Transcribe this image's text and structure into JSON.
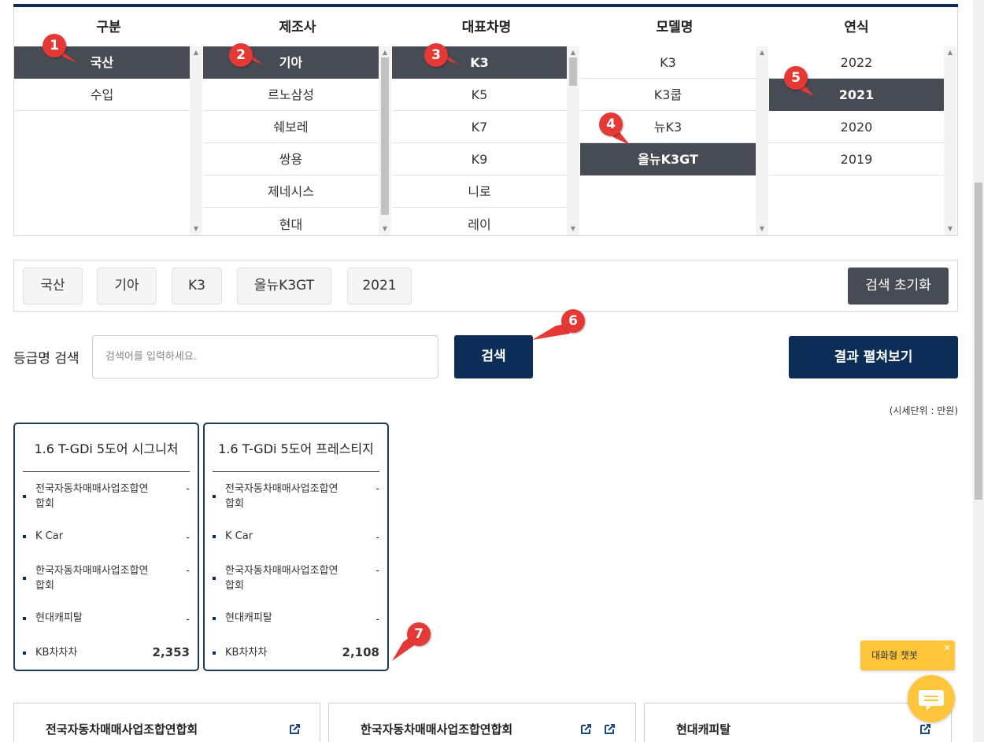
{
  "columns": [
    {
      "header": "구분",
      "items": [
        "국산",
        "수입"
      ],
      "selected": 0
    },
    {
      "header": "제조사",
      "items": [
        "기아",
        "르노삼성",
        "쉐보레",
        "쌍용",
        "제네시스",
        "현대"
      ],
      "selected": 0
    },
    {
      "header": "대표차명",
      "items": [
        "K3",
        "K5",
        "K7",
        "K9",
        "니로",
        "레이"
      ],
      "selected": 0
    },
    {
      "header": "모델명",
      "items": [
        "K3",
        "K3쿱",
        "뉴K3",
        "올뉴K3GT"
      ],
      "selected": 3
    },
    {
      "header": "연식",
      "items": [
        "2022",
        "2021",
        "2020",
        "2019"
      ],
      "selected": 1
    }
  ],
  "chips": [
    "국산",
    "기아",
    "K3",
    "올뉴K3GT",
    "2021"
  ],
  "reset_label": "검색 초기화",
  "search": {
    "label": "등급명 검색",
    "placeholder": "검색어를 입력하세요.",
    "button": "검색",
    "expand_button": "결과 펼쳐보기"
  },
  "unit_note": "(시세단위 : 만원)",
  "cards": [
    {
      "title": "1.6 T-GDi 5도어 시그니처",
      "rows": [
        {
          "name": "전국자동차매매사업조합연합회",
          "value": "-"
        },
        {
          "name": "K Car",
          "value": "-"
        },
        {
          "name": "한국자동차매매사업조합연합회",
          "value": "-"
        },
        {
          "name": "현대캐피탈",
          "value": "-"
        },
        {
          "name": "KB차차차",
          "value": "2,353"
        }
      ]
    },
    {
      "title": "1.6 T-GDi 5도어 프레스티지",
      "rows": [
        {
          "name": "전국자동차매매사업조합연합회",
          "value": "-"
        },
        {
          "name": "K Car",
          "value": "-"
        },
        {
          "name": "한국자동차매매사업조합연합회",
          "value": "-"
        },
        {
          "name": "현대캐피탈",
          "value": "-"
        },
        {
          "name": "KB차차차",
          "value": "2,108"
        }
      ]
    }
  ],
  "badges": [
    "1",
    "2",
    "3",
    "4",
    "5",
    "6",
    "7"
  ],
  "panels": [
    "전국자동차매매사업조합연합회",
    "한국자동차매매사업조합연합회",
    "현대캐피탈"
  ],
  "chatbot": {
    "label": "대화형 챗봇",
    "close": "×"
  },
  "colors": {
    "navy": "#0c2d57",
    "selected_gray": "#474b53",
    "badge_red": "#e53935",
    "chat_yellow": "#ffc63b"
  }
}
